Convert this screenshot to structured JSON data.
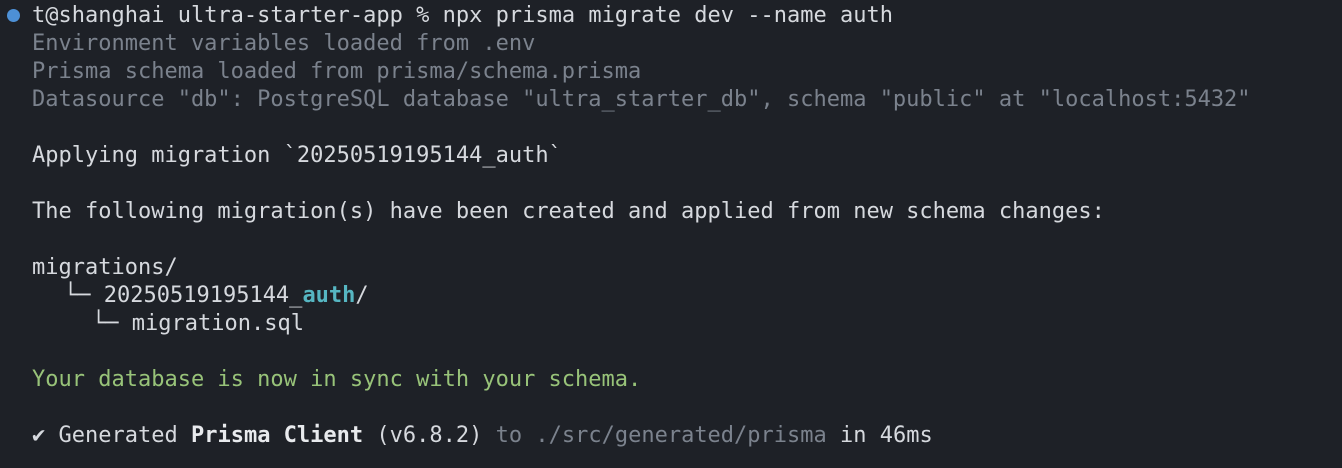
{
  "prompt": {
    "user_host": "t@shanghai",
    "directory": "ultra-starter-app",
    "symbol": "%",
    "command": "npx prisma migrate dev --name auth"
  },
  "info": {
    "env_line": "Environment variables loaded from .env",
    "schema_line": "Prisma schema loaded from prisma/schema.prisma",
    "datasource_line": "Datasource \"db\": PostgreSQL database \"ultra_starter_db\", schema \"public\" at \"localhost:5432\""
  },
  "applying": "Applying migration `20250519195144_auth`",
  "created_notice": "The following migration(s) have been created and applied from new schema changes:",
  "tree": {
    "root": "migrations/",
    "branch1": "└─ ",
    "folder_prefix": "20250519195144_",
    "folder_name": "auth",
    "folder_suffix": "/",
    "branch2": "└─ ",
    "file": "migration.sql"
  },
  "sync_message": "Your database is now in sync with your schema.",
  "generated": {
    "check": "✔",
    "label": "Generated",
    "client": "Prisma Client",
    "version": "(v6.8.2)",
    "to_text": "to",
    "path": "./src/generated/prisma",
    "in_text": "in",
    "duration": "46ms"
  },
  "colors": {
    "background": "#1e2127",
    "prompt_dot": "#4d90d6",
    "success": "#98c379",
    "highlight": "#56b6c2",
    "dim": "#7b828d"
  }
}
